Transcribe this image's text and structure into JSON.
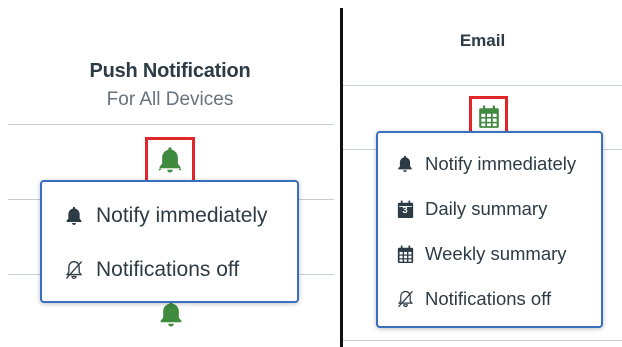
{
  "push": {
    "title": "Push Notification",
    "subtitle": "For All Devices",
    "trigger_icon": "bell-icon",
    "trigger_color": "#3f8a3f",
    "menu": [
      {
        "icon": "bell-icon",
        "label": "Notify immediately"
      },
      {
        "icon": "bell-slash-icon",
        "label": "Notifications off"
      }
    ]
  },
  "email": {
    "title": "Email",
    "trigger_icon": "calendar-grid-icon",
    "trigger_color": "#3f8a3f",
    "menu": [
      {
        "icon": "bell-icon",
        "label": "Notify immediately"
      },
      {
        "icon": "calendar-day-icon",
        "label": "Daily summary",
        "badge": "3"
      },
      {
        "icon": "calendar-grid-icon",
        "label": "Weekly summary"
      },
      {
        "icon": "bell-slash-icon",
        "label": "Notifications off"
      }
    ]
  },
  "colors": {
    "focus_outline": "#e0262b",
    "menu_border": "#3a6fbd",
    "text": "#2d3b45",
    "success_green": "#3f8a3f"
  }
}
